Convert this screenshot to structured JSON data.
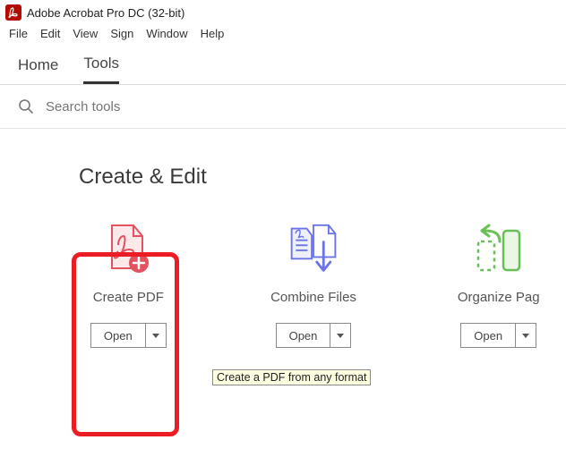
{
  "app": {
    "title": "Adobe Acrobat Pro DC (32-bit)"
  },
  "menu": {
    "file": "File",
    "edit": "Edit",
    "view": "View",
    "sign": "Sign",
    "window": "Window",
    "help": "Help"
  },
  "tabs": {
    "home": "Home",
    "tools": "Tools"
  },
  "search": {
    "placeholder": "Search tools"
  },
  "section": {
    "title": "Create & Edit"
  },
  "cards": {
    "create_pdf": {
      "label": "Create PDF",
      "open": "Open"
    },
    "combine": {
      "label": "Combine Files",
      "open": "Open"
    },
    "organize": {
      "label": "Organize Pag",
      "open": "Open"
    }
  },
  "tooltip": {
    "text": "Create a PDF from any format"
  }
}
